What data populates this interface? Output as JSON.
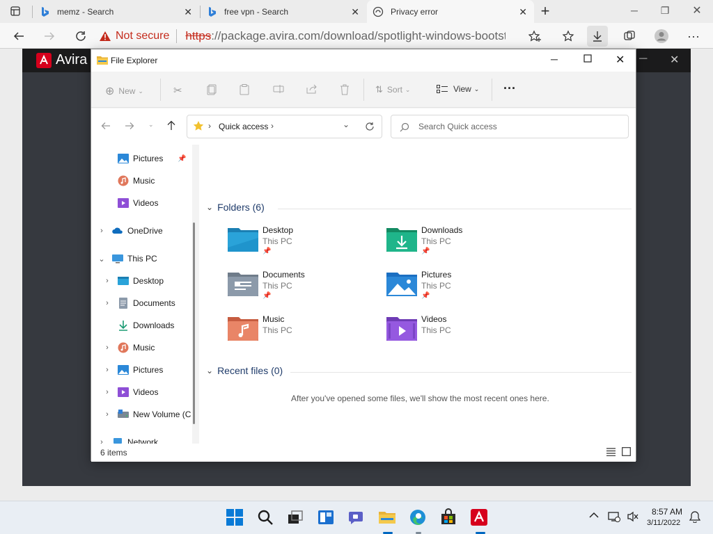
{
  "browser": {
    "tabs": [
      {
        "title": "memz - Search",
        "favicon": "bing-icon"
      },
      {
        "title": "free vpn - Search",
        "favicon": "bing-icon"
      },
      {
        "title": "Privacy error",
        "favicon": "warning-page-icon",
        "active": true
      }
    ],
    "new_tab": "+",
    "security_label": "Not secure",
    "url_scheme": "https",
    "url_rest": "://package.avira.com/download/spotlight-windows-bootst..."
  },
  "page": {
    "brand": "Avira"
  },
  "file_explorer": {
    "title": "File Explorer",
    "toolbar": {
      "new_label": "New",
      "sort_label": "Sort",
      "view_label": "View",
      "more_label": "···"
    },
    "address": {
      "location": "Quick access",
      "search_placeholder": "Search Quick access"
    },
    "nav": [
      {
        "label": "Pictures",
        "icon": "pictures-icon",
        "pinned": true
      },
      {
        "label": "Music",
        "icon": "music-icon"
      },
      {
        "label": "Videos",
        "icon": "videos-icon"
      },
      {
        "label": "OneDrive",
        "icon": "onedrive-icon"
      },
      {
        "label": "This PC",
        "icon": "this-pc-icon"
      },
      {
        "label": "Desktop",
        "icon": "desktop-icon"
      },
      {
        "label": "Documents",
        "icon": "documents-icon"
      },
      {
        "label": "Downloads",
        "icon": "downloads-icon"
      },
      {
        "label": "Music",
        "icon": "music-icon"
      },
      {
        "label": "Pictures",
        "icon": "pictures-icon"
      },
      {
        "label": "Videos",
        "icon": "videos-icon"
      },
      {
        "label": "New Volume (C",
        "icon": "drive-icon"
      },
      {
        "label": "Network",
        "icon": "network-icon"
      }
    ],
    "folders_header": "Folders (6)",
    "folders": [
      {
        "name": "Desktop",
        "location": "This PC",
        "pinned": "📌"
      },
      {
        "name": "Downloads",
        "location": "This PC",
        "pinned": "📌"
      },
      {
        "name": "Documents",
        "location": "This PC",
        "pinned": "📌"
      },
      {
        "name": "Pictures",
        "location": "This PC",
        "pinned": "📌"
      },
      {
        "name": "Music",
        "location": "This PC"
      },
      {
        "name": "Videos",
        "location": "This PC"
      }
    ],
    "recent_header": "Recent files (0)",
    "recent_empty": "After you've opened some files, we'll show the most recent ones here.",
    "status": "6 items"
  },
  "taskbar": {
    "time": "8:57 AM",
    "date": "3/11/2022"
  },
  "colors": {
    "accent": "#0067c0",
    "danger": "#c42b1c",
    "avira_red": "#d6001c"
  }
}
